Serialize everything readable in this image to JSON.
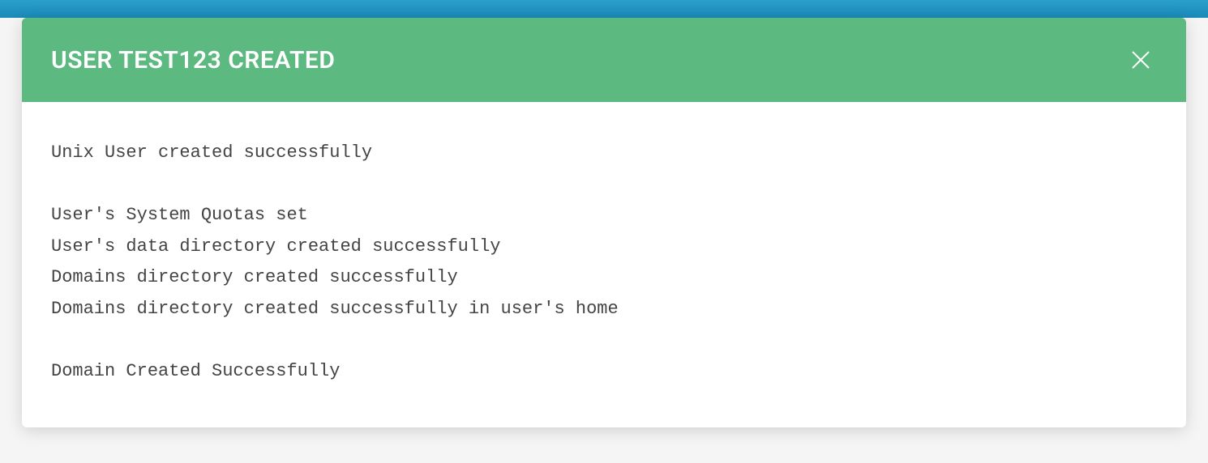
{
  "modal": {
    "title": "USER TEST123 CREATED",
    "messages": [
      "Unix User created successfully",
      "",
      "User's System Quotas set",
      "User's data directory created successfully",
      "Domains directory created successfully",
      "Domains directory created successfully in user's home",
      "",
      "Domain Created Successfully"
    ]
  }
}
